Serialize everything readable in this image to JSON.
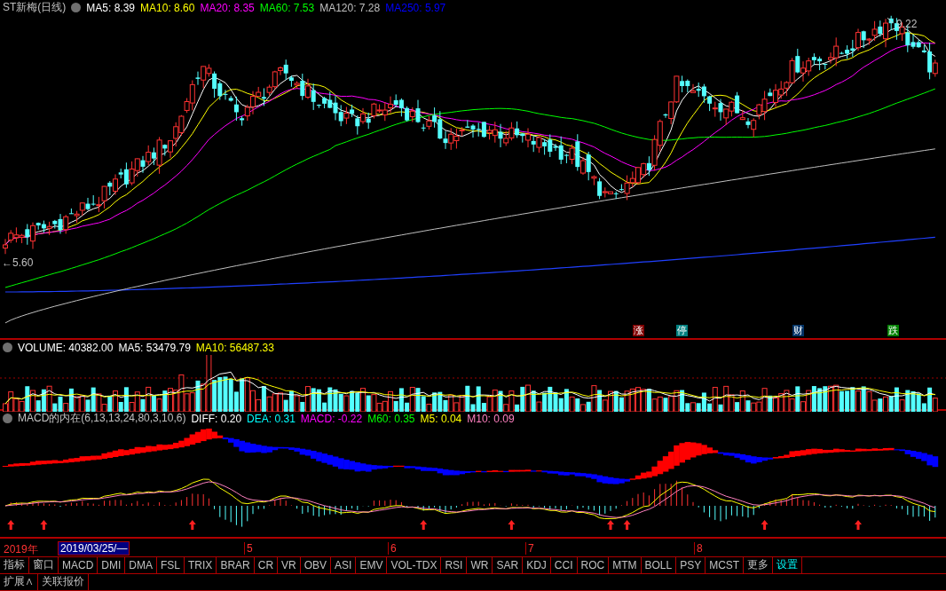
{
  "main_panel": {
    "title": "ST新梅(日线)",
    "legend": [
      {
        "text": "MA5: 8.39",
        "color": "#ffffff"
      },
      {
        "text": "MA10: 8.60",
        "color": "#ffff00"
      },
      {
        "text": "MA20: 8.35",
        "color": "#ff00ff"
      },
      {
        "text": "MA60: 7.53",
        "color": "#00ff00"
      },
      {
        "text": "MA120: 7.28",
        "color": "#c0c0c0"
      },
      {
        "text": "MA250: 5.97",
        "color": "#0000ff"
      }
    ],
    "high_label": "9.22",
    "low_label": "←5.60",
    "events": [
      {
        "text": "涨",
        "color": "#800000"
      },
      {
        "text": "停",
        "color": "#008080"
      },
      {
        "text": "财",
        "color": "#003366"
      },
      {
        "text": "跌",
        "color": "#008000"
      }
    ]
  },
  "volume_panel": {
    "legend": [
      {
        "text": "VOLUME: 40382.00",
        "color": "#ffffff"
      },
      {
        "text": "MA5: 53479.79",
        "color": "#ffffff"
      },
      {
        "text": "MA10: 56487.33",
        "color": "#ffff00"
      }
    ]
  },
  "macd_panel": {
    "legend": [
      {
        "text": "MACD的内在(6,13,13,24,80,3,10,6)",
        "color": "#c0c0c0"
      },
      {
        "text": "DIFF: 0.20",
        "color": "#ffffff"
      },
      {
        "text": "DEA: 0.31",
        "color": "#00ffff"
      },
      {
        "text": "MACD: -0.22",
        "color": "#ff00ff"
      },
      {
        "text": "M60: 0.35",
        "color": "#00ff00"
      },
      {
        "text": "M5: 0.04",
        "color": "#ffff00"
      },
      {
        "text": "M10: 0.09",
        "color": "#ff80c0"
      }
    ]
  },
  "date_axis": {
    "year": "2019年",
    "cursor_date": "2019/03/25/—",
    "months": [
      "5",
      "6",
      "7",
      "8"
    ]
  },
  "indicator_tabs": [
    {
      "label": "指标",
      "kind": "tab"
    },
    {
      "label": "窗口",
      "kind": "tab"
    },
    {
      "label": "MACD",
      "kind": "tab"
    },
    {
      "label": "DMI",
      "kind": "tab"
    },
    {
      "label": "DMA",
      "kind": "tab"
    },
    {
      "label": "FSL",
      "kind": "tab"
    },
    {
      "label": "TRIX",
      "kind": "tab"
    },
    {
      "label": "BRAR",
      "kind": "tab"
    },
    {
      "label": "CR",
      "kind": "tab"
    },
    {
      "label": "VR",
      "kind": "tab"
    },
    {
      "label": "OBV",
      "kind": "tab"
    },
    {
      "label": "ASI",
      "kind": "tab"
    },
    {
      "label": "EMV",
      "kind": "tab"
    },
    {
      "label": "VOL-TDX",
      "kind": "tab"
    },
    {
      "label": "RSI",
      "kind": "tab"
    },
    {
      "label": "WR",
      "kind": "tab"
    },
    {
      "label": "SAR",
      "kind": "tab"
    },
    {
      "label": "KDJ",
      "kind": "tab"
    },
    {
      "label": "CCI",
      "kind": "tab"
    },
    {
      "label": "ROC",
      "kind": "tab"
    },
    {
      "label": "MTM",
      "kind": "tab"
    },
    {
      "label": "BOLL",
      "kind": "tab"
    },
    {
      "label": "PSY",
      "kind": "tab"
    },
    {
      "label": "MCST",
      "kind": "tab"
    },
    {
      "label": "更多",
      "kind": "tab"
    },
    {
      "label": "设置",
      "kind": "settings"
    }
  ],
  "bottom_tabs": [
    {
      "label": "扩展∧"
    },
    {
      "label": "关联报价"
    }
  ]
}
